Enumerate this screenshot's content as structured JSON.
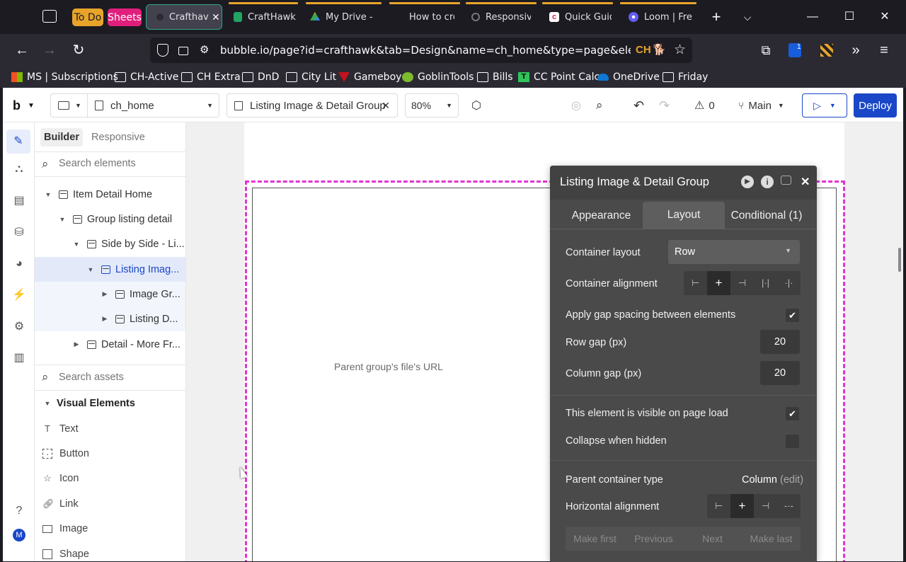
{
  "browser": {
    "tabs": [
      {
        "label": "Crafthav",
        "active": true
      },
      {
        "label": "CraftHawk"
      },
      {
        "label": "My Drive -"
      },
      {
        "label": "How to cre"
      },
      {
        "label": "Responsive"
      },
      {
        "label": "Quick Guid"
      },
      {
        "label": "Loom | Fre"
      }
    ],
    "tab_groups": [
      {
        "label": "To Do",
        "color": "#e8a42a"
      },
      {
        "label": "Sheets",
        "color": "#e01f7c"
      }
    ],
    "url": "bubble.io/page?id=crafthawk&tab=Design&name=ch_home&type=page&elements=",
    "url_badge": "CH",
    "extension_badge": "1",
    "bookmarks": [
      "MS | Subscriptions",
      "CH-Active",
      "CH Extra",
      "DnD",
      "City Lit",
      "Gameboy",
      "GoblinTools",
      "Bills",
      "CC Point Calc",
      "OneDrive",
      "Friday"
    ]
  },
  "editor": {
    "logo": "b",
    "page_select": "ch_home",
    "element_select": "Listing Image & Detail Group",
    "zoom": "80%",
    "issues_count": "0",
    "branch": "Main",
    "deploy_label": "Deploy",
    "panel_tabs": {
      "builder": "Builder",
      "responsive": "Responsive"
    },
    "search_elements_placeholder": "Search elements",
    "search_assets_placeholder": "Search assets",
    "tree": [
      {
        "label": "Item Detail Home"
      },
      {
        "label": "Group listing detail"
      },
      {
        "label": "Side by Side - Li..."
      },
      {
        "label": "Listing Imag..."
      },
      {
        "label": "Image Gr..."
      },
      {
        "label": "Listing D..."
      },
      {
        "label": "Detail - More Fr..."
      }
    ],
    "visual_elements_header": "Visual Elements",
    "visual_elements": [
      "Text",
      "Button",
      "Icon",
      "Link",
      "Image",
      "Shape"
    ],
    "avatar_letter": "M"
  },
  "canvas": {
    "placeholder_text": "Parent group's file's URL"
  },
  "property_editor": {
    "title": "Listing Image & Detail Group",
    "tabs": [
      "Appearance",
      "Layout",
      "Conditional (1)"
    ],
    "active_tab": "Layout",
    "container_layout_label": "Container layout",
    "container_layout_value": "Row",
    "container_alignment_label": "Container alignment",
    "gap_label": "Apply gap spacing between elements",
    "gap_checked": true,
    "row_gap_label": "Row gap (px)",
    "row_gap_value": "20",
    "column_gap_label": "Column gap (px)",
    "column_gap_value": "20",
    "visible_label": "This element is visible on page load",
    "visible_checked": true,
    "collapse_label": "Collapse when hidden",
    "collapse_checked": false,
    "parent_type_label": "Parent container type",
    "parent_type_value": "Column",
    "parent_type_edit": "(edit)",
    "horizontal_alignment_label": "Horizontal alignment",
    "order_buttons": [
      "Make first",
      "Previous",
      "Next",
      "Make last"
    ]
  },
  "colors": {
    "accent_blue": "#1a47c8",
    "selection_magenta": "#e233d4",
    "panel_dark": "#4a4a4a"
  }
}
